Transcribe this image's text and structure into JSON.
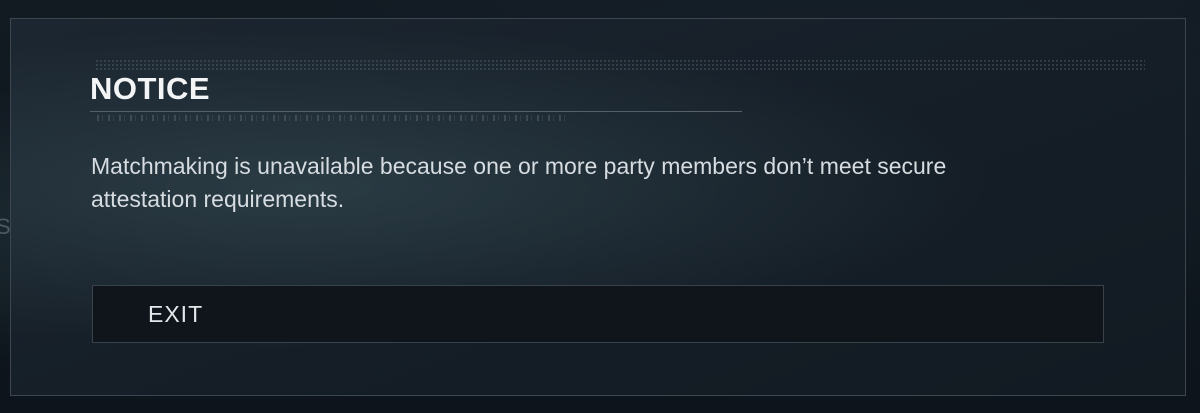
{
  "background": {
    "partial_text": "S"
  },
  "notice": {
    "title": "NOTICE",
    "message": "Matchmaking is unavailable because one or more party members don’t meet secure attestation requirements."
  },
  "actions": {
    "exit_label": "EXIT"
  },
  "colors": {
    "panel_background": "#18222b",
    "panel_border": "#3d4650",
    "button_background": "#0f151b",
    "text_primary": "#f2f4f5",
    "text_body": "#d6dce0"
  }
}
